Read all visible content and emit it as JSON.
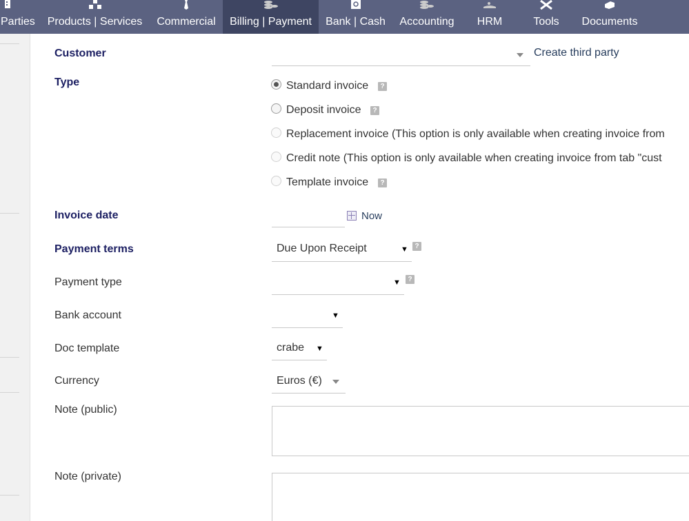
{
  "topnav": {
    "items": [
      {
        "label": "Parties",
        "icon": "building-icon"
      },
      {
        "label": "Products | Services",
        "icon": "boxes-icon"
      },
      {
        "label": "Commercial",
        "icon": "tie-icon"
      },
      {
        "label": "Billing | Payment",
        "icon": "coins-icon",
        "active": true
      },
      {
        "label": "Bank | Cash",
        "icon": "safe-icon"
      },
      {
        "label": "Accounting",
        "icon": "coins-icon"
      },
      {
        "label": "HRM",
        "icon": "people-icon"
      },
      {
        "label": "Tools",
        "icon": "tools-icon"
      },
      {
        "label": "Documents",
        "icon": "folder-icon"
      }
    ]
  },
  "form": {
    "customer": {
      "label": "Customer",
      "value": "",
      "create_link": "Create third party"
    },
    "type": {
      "label": "Type",
      "options": [
        {
          "label": "Standard invoice",
          "checked": true,
          "enabled": true,
          "help": true
        },
        {
          "label": "Deposit invoice",
          "checked": false,
          "enabled": true,
          "help": true
        },
        {
          "label": "Replacement invoice (This option is only available when creating invoice from",
          "checked": false,
          "enabled": false,
          "help": false
        },
        {
          "label": "Credit note (This option is only available when creating invoice from tab \"cust",
          "checked": false,
          "enabled": false,
          "help": false
        },
        {
          "label": "Template invoice",
          "checked": false,
          "enabled": false,
          "help": true
        }
      ]
    },
    "invoice_date": {
      "label": "Invoice date",
      "value": "",
      "now_link": "Now"
    },
    "payment_terms": {
      "label": "Payment terms",
      "value": "Due Upon Receipt"
    },
    "payment_type": {
      "label": "Payment type",
      "value": ""
    },
    "bank_account": {
      "label": "Bank account",
      "value": ""
    },
    "doc_template": {
      "label": "Doc template",
      "value": "crabe"
    },
    "currency": {
      "label": "Currency",
      "value": "Euros (€)"
    },
    "note_public": {
      "label": "Note (public)",
      "value": ""
    },
    "note_private": {
      "label": "Note (private)",
      "value": ""
    }
  },
  "colors": {
    "nav_bg": "#5b6281",
    "nav_active": "#3e4562",
    "required_label": "#1d2063",
    "link": "#263c5c"
  }
}
